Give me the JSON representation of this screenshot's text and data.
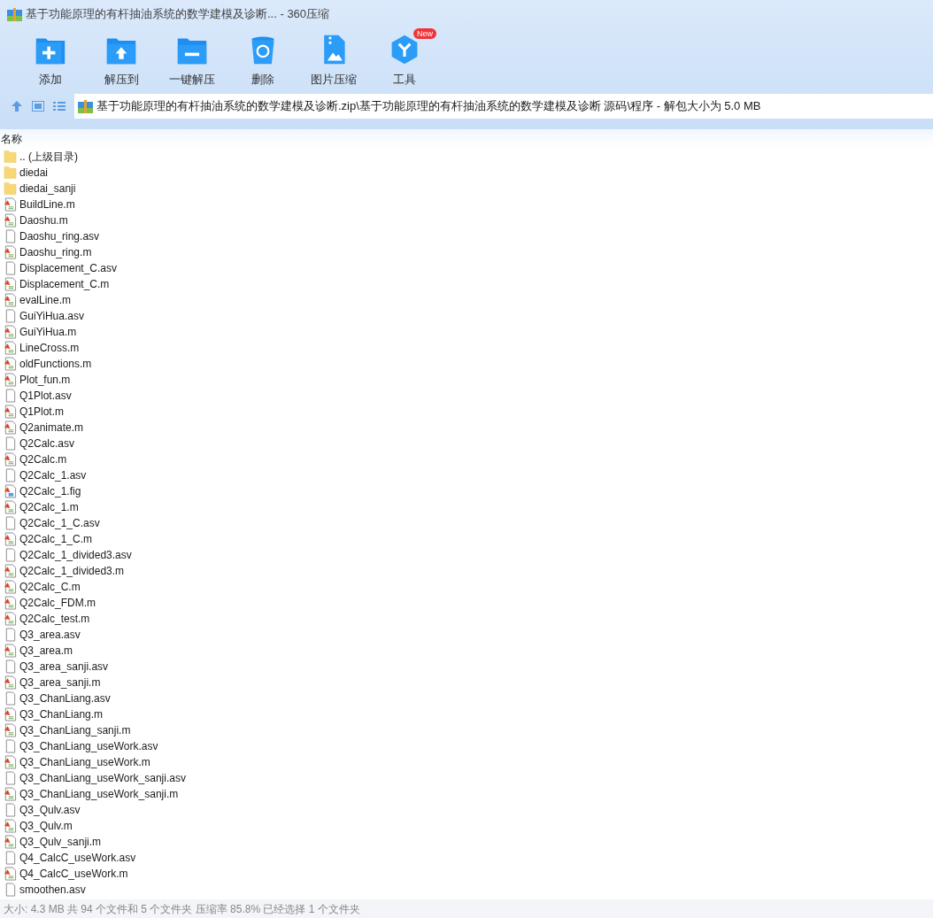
{
  "window": {
    "title": "基于功能原理的有杆抽油系统的数学建模及诊断... - 360压缩"
  },
  "toolbar": [
    {
      "kind": "add",
      "label": "添加"
    },
    {
      "kind": "extract",
      "label": "解压到"
    },
    {
      "kind": "quick",
      "label": "一键解压"
    },
    {
      "kind": "delete",
      "label": "删除"
    },
    {
      "kind": "image",
      "label": "图片压缩"
    },
    {
      "kind": "tools",
      "label": "工具",
      "badge": "New"
    }
  ],
  "address": {
    "path": "基于功能原理的有杆抽油系统的数学建模及诊断.zip\\基于功能原理的有杆抽油系统的数学建模及诊断 源码\\程序 - 解包大小为 5.0 MB"
  },
  "table": {
    "columns": [
      "名称"
    ],
    "rows": [
      {
        "kind": "folder",
        "name": ".. (上级目录)"
      },
      {
        "kind": "folder",
        "name": "diedai"
      },
      {
        "kind": "folder",
        "name": "diedai_sanji"
      },
      {
        "kind": "m",
        "name": "BuildLine.m"
      },
      {
        "kind": "m",
        "name": "Daoshu.m"
      },
      {
        "kind": "file",
        "name": "Daoshu_ring.asv"
      },
      {
        "kind": "m",
        "name": "Daoshu_ring.m"
      },
      {
        "kind": "file",
        "name": "Displacement_C.asv"
      },
      {
        "kind": "m",
        "name": "Displacement_C.m"
      },
      {
        "kind": "m",
        "name": "evalLine.m"
      },
      {
        "kind": "file",
        "name": "GuiYiHua.asv"
      },
      {
        "kind": "m",
        "name": "GuiYiHua.m"
      },
      {
        "kind": "m",
        "name": "LineCross.m"
      },
      {
        "kind": "m",
        "name": "oldFunctions.m"
      },
      {
        "kind": "m",
        "name": "Plot_fun.m"
      },
      {
        "kind": "file",
        "name": "Q1Plot.asv"
      },
      {
        "kind": "m",
        "name": "Q1Plot.m"
      },
      {
        "kind": "m",
        "name": "Q2animate.m"
      },
      {
        "kind": "file",
        "name": "Q2Calc.asv"
      },
      {
        "kind": "m",
        "name": "Q2Calc.m"
      },
      {
        "kind": "file",
        "name": "Q2Calc_1.asv"
      },
      {
        "kind": "fig",
        "name": "Q2Calc_1.fig"
      },
      {
        "kind": "m",
        "name": "Q2Calc_1.m"
      },
      {
        "kind": "file",
        "name": "Q2Calc_1_C.asv"
      },
      {
        "kind": "m",
        "name": "Q2Calc_1_C.m"
      },
      {
        "kind": "file",
        "name": "Q2Calc_1_divided3.asv"
      },
      {
        "kind": "m",
        "name": "Q2Calc_1_divided3.m"
      },
      {
        "kind": "m",
        "name": "Q2Calc_C.m"
      },
      {
        "kind": "m",
        "name": "Q2Calc_FDM.m"
      },
      {
        "kind": "m",
        "name": "Q2Calc_test.m"
      },
      {
        "kind": "file",
        "name": "Q3_area.asv"
      },
      {
        "kind": "m",
        "name": "Q3_area.m"
      },
      {
        "kind": "file",
        "name": "Q3_area_sanji.asv"
      },
      {
        "kind": "m",
        "name": "Q3_area_sanji.m"
      },
      {
        "kind": "file",
        "name": "Q3_ChanLiang.asv"
      },
      {
        "kind": "m",
        "name": "Q3_ChanLiang.m"
      },
      {
        "kind": "m",
        "name": "Q3_ChanLiang_sanji.m"
      },
      {
        "kind": "file",
        "name": "Q3_ChanLiang_useWork.asv"
      },
      {
        "kind": "m",
        "name": "Q3_ChanLiang_useWork.m"
      },
      {
        "kind": "file",
        "name": "Q3_ChanLiang_useWork_sanji.asv"
      },
      {
        "kind": "m",
        "name": "Q3_ChanLiang_useWork_sanji.m"
      },
      {
        "kind": "file",
        "name": "Q3_Qulv.asv"
      },
      {
        "kind": "m",
        "name": "Q3_Qulv.m"
      },
      {
        "kind": "m",
        "name": "Q3_Qulv_sanji.m"
      },
      {
        "kind": "file",
        "name": "Q4_CalcC_useWork.asv"
      },
      {
        "kind": "m",
        "name": "Q4_CalcC_useWork.m"
      },
      {
        "kind": "file",
        "name": "smoothen.asv"
      }
    ]
  },
  "status_bar": "大小: 4.3 MB 共 94 个文件和 5 个文件夹 压缩率 85.8% 已经选择 1 个文件夹"
}
